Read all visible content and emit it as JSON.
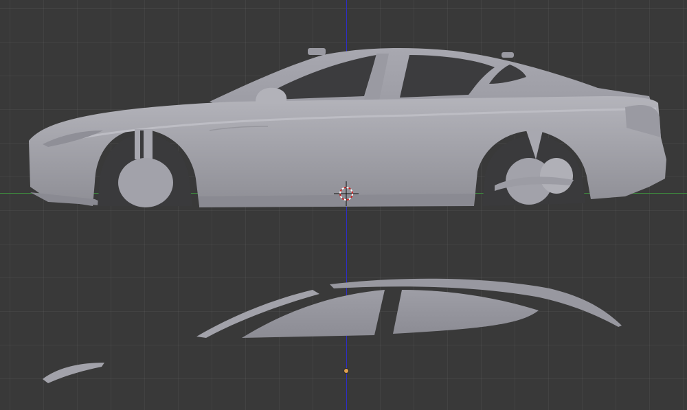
{
  "viewport": {
    "background": "#393939",
    "grid_color": "#444444",
    "x_axis_color": "#3e8a3e",
    "y_axis_color": "#2c2cc8"
  },
  "scene": {
    "model": "car-body-side-view",
    "reflection": "car-glass-reflection",
    "mesh_color": "#a6a6ac"
  },
  "cursor": {
    "icon": "3d-cursor-icon",
    "colors": [
      "#ffffff",
      "#cc2222"
    ]
  },
  "origin": {
    "icon": "object-origin-dot",
    "color": "#e0a050"
  }
}
